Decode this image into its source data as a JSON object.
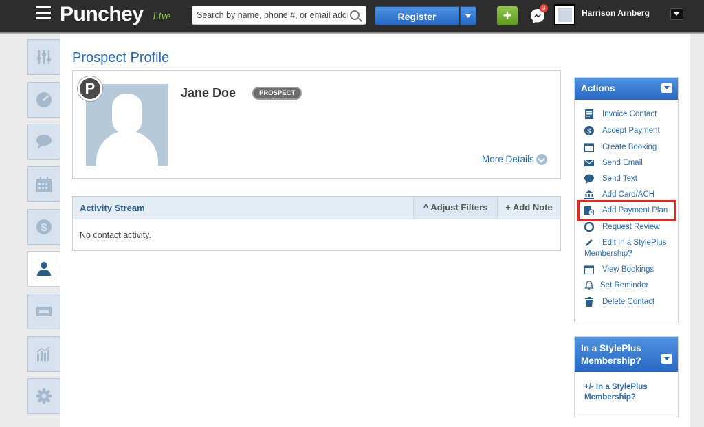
{
  "header": {
    "brand": "Punchey",
    "brand_suffix": "Live",
    "search_placeholder": "Search by name, phone #, or email address",
    "register_label": "Register",
    "add_label": "+",
    "message_count": "3",
    "user_name": "Harrison Arnberg"
  },
  "sidebar": {
    "items": [
      {
        "name": "sidebar-item-settings-sliders",
        "icon": "sliders-icon"
      },
      {
        "name": "sidebar-item-dashboard",
        "icon": "gauge-icon"
      },
      {
        "name": "sidebar-item-messages",
        "icon": "chat-icon"
      },
      {
        "name": "sidebar-item-calendar",
        "icon": "calendar-icon"
      },
      {
        "name": "sidebar-item-payments",
        "icon": "dollar-icon"
      },
      {
        "name": "sidebar-item-contacts",
        "icon": "person-icon",
        "active": true
      },
      {
        "name": "sidebar-item-tickets",
        "icon": "ticket-icon"
      },
      {
        "name": "sidebar-item-reports",
        "icon": "bar-chart-icon"
      },
      {
        "name": "sidebar-item-settings",
        "icon": "gear-icon"
      }
    ]
  },
  "main": {
    "page_title": "Prospect Profile",
    "profile": {
      "badge_letter": "P",
      "name": "Jane Doe",
      "status": "PROSPECT",
      "more_details": "More Details"
    },
    "activity": {
      "title": "Activity Stream",
      "adjust_filters": "^ Adjust Filters",
      "add_note": "+ Add Note",
      "empty_text": "No contact activity."
    }
  },
  "actions_panel": {
    "title": "Actions",
    "items": [
      {
        "label": "Invoice Contact",
        "icon": "invoice-icon"
      },
      {
        "label": "Accept Payment",
        "icon": "dollar-circle-icon"
      },
      {
        "label": "Create Booking",
        "icon": "calendar-icon"
      },
      {
        "label": "Send Email",
        "icon": "envelope-icon"
      },
      {
        "label": "Send Text",
        "icon": "text-bubble-icon"
      },
      {
        "label": "Add Card/ACH",
        "icon": "bank-icon"
      },
      {
        "label": "Add Payment Plan",
        "icon": "payment-plan-icon",
        "highlighted": true
      },
      {
        "label": "Request Review",
        "icon": "review-icon"
      },
      {
        "label": "Edit In a StylePlus Membership?",
        "icon": "pencil-icon"
      },
      {
        "label": "View Bookings",
        "icon": "calendar-icon"
      },
      {
        "label": "Set Reminder",
        "icon": "bell-icon"
      },
      {
        "label": "Delete Contact",
        "icon": "trash-icon"
      }
    ]
  },
  "membership_panel": {
    "title": "In a StylePlus Membership?",
    "link": "+/- In a StylePlus Membership?"
  },
  "colors": {
    "accent_blue": "#2868c4",
    "link_blue": "#2b6cb0",
    "highlight_red": "#e8261f",
    "add_green": "#6fae2e"
  }
}
